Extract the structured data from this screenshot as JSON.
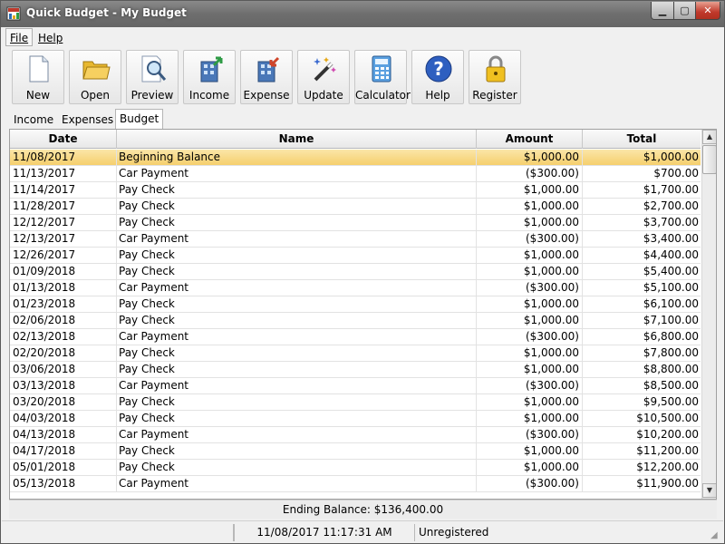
{
  "window": {
    "title": "Quick Budget - My Budget"
  },
  "menu": [
    {
      "label": "File"
    },
    {
      "label": "Help"
    }
  ],
  "toolbar": [
    {
      "label": "New",
      "icon": "new-document-icon"
    },
    {
      "label": "Open",
      "icon": "folder-icon"
    },
    {
      "label": "Preview",
      "icon": "magnifier-icon"
    },
    {
      "label": "Income",
      "icon": "building-income-icon"
    },
    {
      "label": "Expense",
      "icon": "building-expense-icon"
    },
    {
      "label": "Update",
      "icon": "magic-wand-icon"
    },
    {
      "label": "Calculator",
      "icon": "calculator-icon"
    },
    {
      "label": "Help",
      "icon": "help-icon"
    },
    {
      "label": "Register",
      "icon": "padlock-icon"
    }
  ],
  "tabs": [
    {
      "label": "Income"
    },
    {
      "label": "Expenses"
    },
    {
      "label": "Budget",
      "active": true
    }
  ],
  "table": {
    "columns": [
      "Date",
      "Name",
      "Amount",
      "Total"
    ],
    "rows": [
      [
        "11/08/2017",
        "Beginning Balance",
        "$1,000.00",
        "$1,000.00"
      ],
      [
        "11/13/2017",
        "Car Payment",
        "($300.00)",
        "$700.00"
      ],
      [
        "11/14/2017",
        "Pay Check",
        "$1,000.00",
        "$1,700.00"
      ],
      [
        "11/28/2017",
        "Pay Check",
        "$1,000.00",
        "$2,700.00"
      ],
      [
        "12/12/2017",
        "Pay Check",
        "$1,000.00",
        "$3,700.00"
      ],
      [
        "12/13/2017",
        "Car Payment",
        "($300.00)",
        "$3,400.00"
      ],
      [
        "12/26/2017",
        "Pay Check",
        "$1,000.00",
        "$4,400.00"
      ],
      [
        "01/09/2018",
        "Pay Check",
        "$1,000.00",
        "$5,400.00"
      ],
      [
        "01/13/2018",
        "Car Payment",
        "($300.00)",
        "$5,100.00"
      ],
      [
        "01/23/2018",
        "Pay Check",
        "$1,000.00",
        "$6,100.00"
      ],
      [
        "02/06/2018",
        "Pay Check",
        "$1,000.00",
        "$7,100.00"
      ],
      [
        "02/13/2018",
        "Car Payment",
        "($300.00)",
        "$6,800.00"
      ],
      [
        "02/20/2018",
        "Pay Check",
        "$1,000.00",
        "$7,800.00"
      ],
      [
        "03/06/2018",
        "Pay Check",
        "$1,000.00",
        "$8,800.00"
      ],
      [
        "03/13/2018",
        "Car Payment",
        "($300.00)",
        "$8,500.00"
      ],
      [
        "03/20/2018",
        "Pay Check",
        "$1,000.00",
        "$9,500.00"
      ],
      [
        "04/03/2018",
        "Pay Check",
        "$1,000.00",
        "$10,500.00"
      ],
      [
        "04/13/2018",
        "Car Payment",
        "($300.00)",
        "$10,200.00"
      ],
      [
        "04/17/2018",
        "Pay Check",
        "$1,000.00",
        "$11,200.00"
      ],
      [
        "05/01/2018",
        "Pay Check",
        "$1,000.00",
        "$12,200.00"
      ],
      [
        "05/13/2018",
        "Car Payment",
        "($300.00)",
        "$11,900.00"
      ]
    ],
    "selected_row": 0
  },
  "ending_balance": "Ending Balance: $136,400.00",
  "status": {
    "left": "",
    "datetime": "11/08/2017 11:17:31 AM",
    "registration": "Unregistered"
  },
  "colors": {
    "selection": "#f5cf6d",
    "close_button": "#c0392b"
  }
}
